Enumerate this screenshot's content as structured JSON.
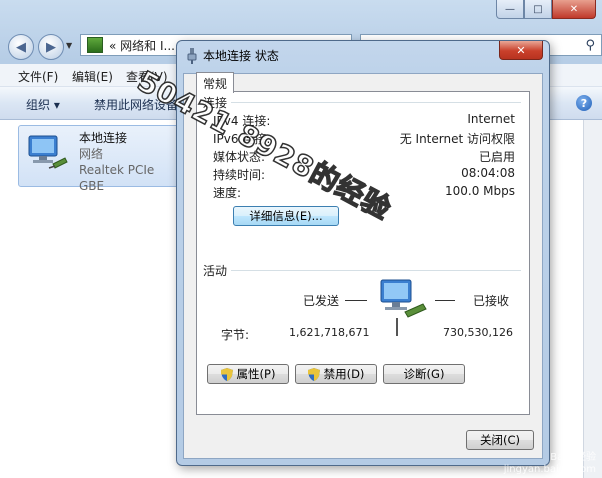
{
  "explorer": {
    "breadcrumb": "«  网络和 I...",
    "menu": [
      "文件(F)",
      "编辑(E)",
      "查看(V)"
    ],
    "toolbar": {
      "organize": "组织 ▾",
      "disable": "禁用此网络设备"
    },
    "adapter": {
      "name": "本地连接",
      "type": "网络",
      "device": "Realtek PCIe GBE"
    }
  },
  "dialog": {
    "title": "本地连接 状态",
    "tab": "常规",
    "connection": {
      "group_label": "连接",
      "rows": [
        {
          "label": "IPv4 连接:",
          "value": "Internet"
        },
        {
          "label": "IPv6 连接:",
          "value": "无 Internet 访问权限"
        },
        {
          "label": "媒体状态:",
          "value": "已启用"
        },
        {
          "label": "持续时间:",
          "value": "08:04:08"
        },
        {
          "label": "速度:",
          "value": "100.0 Mbps"
        }
      ],
      "details_button": "详细信息(E)..."
    },
    "activity": {
      "group_label": "活动",
      "sent_label": "已发送",
      "received_label": "已接收",
      "bytes_label": "字节:",
      "bytes_sent": "1,621,718,671",
      "bytes_received": "730,530,126"
    },
    "buttons": {
      "properties": "属性(P)",
      "disable": "禁用(D)",
      "diagnose": "诊断(G)",
      "close": "关闭(C)"
    }
  },
  "watermark": "50421 8928的经验",
  "site_mark": "Bai百经验\njingyan.baidu.com"
}
